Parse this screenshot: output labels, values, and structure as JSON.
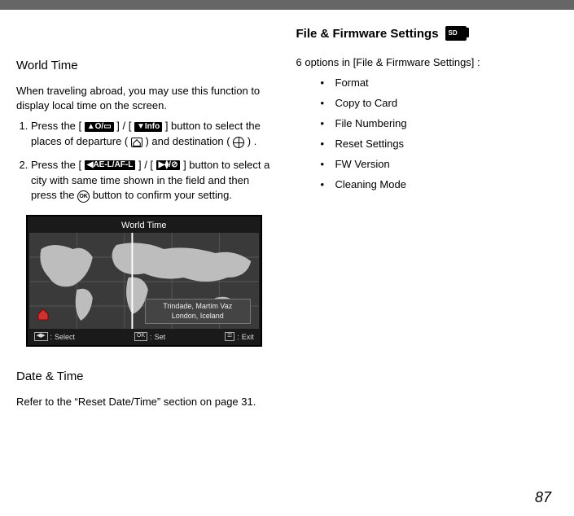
{
  "left": {
    "h_world_time": "World Time",
    "intro": "When traveling abroad, you may use this function to display local time on the screen.",
    "step1_a": "Press the [ ",
    "step1_b": " ] / [ ",
    "step1_info": "Info",
    "step1_c": " ] button to select the places of departure ( ",
    "step1_d": " ) and destination ( ",
    "step1_e": " ) .",
    "step2_a": "Press the [ ",
    "step2_ael": "AE-L",
    "step2_afl": "AF-L",
    "step2_b": " ] / [ ",
    "step2_c": " ] button to select a city with same time shown in the field and then press the ",
    "step2_ok": "OK",
    "step2_d": " button to confirm your setting.",
    "h_date_time": "Date & Time",
    "date_time_p": "Refer to the “Reset Date/Time” section on page 31."
  },
  "right": {
    "ff_title": "File & Firmware Settings",
    "intro": "6 options in [File & Firmware Settings] :",
    "items": [
      "Format",
      "Copy to Card",
      "File Numbering",
      "Reset Settings",
      "FW Version",
      "Cleaning Mode"
    ]
  },
  "wt_screen": {
    "title": "World Time",
    "city1": "Trindade, Martim Vaz",
    "city2": "London, Iceland",
    "select": "Select",
    "set": "Set",
    "exit": "Exit"
  },
  "page_number": "87"
}
